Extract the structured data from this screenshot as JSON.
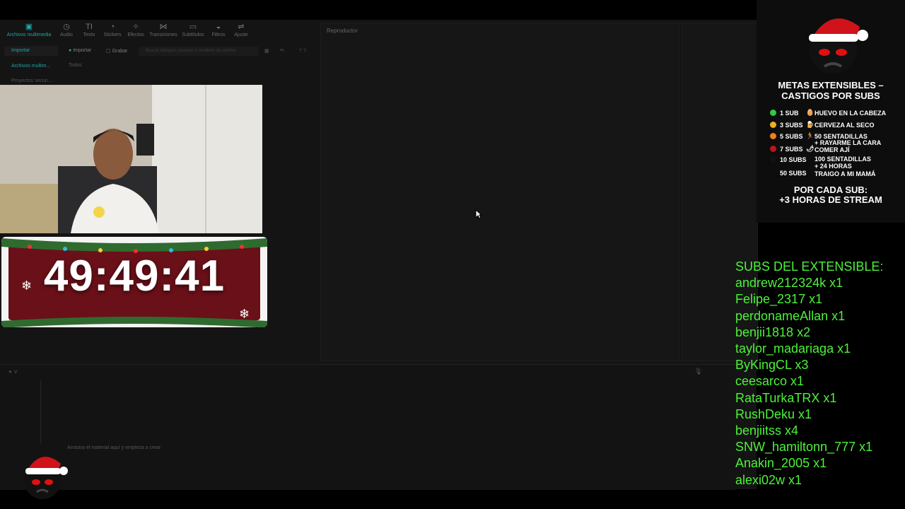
{
  "editor": {
    "toolbar": [
      {
        "label": "Archivos multimedia",
        "icon": "media-icon",
        "active": true
      },
      {
        "label": "Audio",
        "icon": "audio-icon"
      },
      {
        "label": "Texto",
        "icon": "text-icon"
      },
      {
        "label": "Stickers",
        "icon": "sticker-icon"
      },
      {
        "label": "Efectos",
        "icon": "effects-icon"
      },
      {
        "label": "Transiciones",
        "icon": "transitions-icon"
      },
      {
        "label": "Subtítulos",
        "icon": "subtitles-icon"
      },
      {
        "label": "Filtros",
        "icon": "filters-icon"
      },
      {
        "label": "Ajuste",
        "icon": "adjust-icon"
      }
    ],
    "left_nav": [
      "Importar",
      "Archivos multim...",
      "Proyectos secun..."
    ],
    "import_button": "Importar",
    "record_button": "Grabar",
    "search_placeholder": "Buscar diálogos, escenas o nombres de archivo",
    "filter_all": "Todos",
    "player_label": "Reproductor",
    "timeline_hint": "Arrastra el material aquí y empieza a crear"
  },
  "timer": {
    "value": "49:49:41"
  },
  "goals": {
    "title_line1": "METAS EXTENSIBLES –",
    "title_line2": "CASTIGOS POR SUBS",
    "rows": [
      {
        "subs": "1 SUB",
        "color": "#2ecc40",
        "emoji": "🥚",
        "reward": "HUEVO EN LA CABEZA"
      },
      {
        "subs": "3 SUBS",
        "color": "#f2b01e",
        "emoji": "🍺",
        "reward": "CERVEZA AL SECO"
      },
      {
        "subs": "5 SUBS",
        "color": "#f07f15",
        "emoji": "🏃",
        "reward": "50 SENTADILLAS"
      },
      {
        "subs": "",
        "color": "",
        "emoji": "",
        "reward": "+ RAYARME LA CARA"
      },
      {
        "subs": "7 SUBS",
        "color": "#c0141b",
        "emoji": "🌶",
        "reward": "COMER AJÍ"
      },
      {
        "subs": "10 SUBS",
        "color": "#111111",
        "emoji": "",
        "reward": "100 SENTADILLAS"
      },
      {
        "subs": "",
        "color": "",
        "emoji": "",
        "reward": "+ 24 HORAS"
      },
      {
        "subs": "50 SUBS",
        "color": "",
        "emoji": "",
        "reward": "TRAIGO A MI MAMÁ"
      }
    ],
    "footer_line1": "POR CADA SUB:",
    "footer_line2": "+3 HORAS DE STREAM"
  },
  "subs_list": {
    "header": "SUBS DEL EXTENSIBLE:",
    "entries": [
      "andrew212324k x1",
      "Felipe_2317 x1",
      "perdonameAllan x1",
      "benjii1818 x2",
      "taylor_madariaga x1",
      "ByKingCL x3",
      "ceesarco x1",
      "RataTurkaTRX x1",
      "RushDeku x1",
      "benjiitss x4",
      "SNW_hamiltonn_777 x1",
      "Anakin_2005 x1",
      "alexi02w x1"
    ]
  },
  "colors": {
    "accent": "#1fa7a7",
    "subs_green": "#4cf23a",
    "timer_bg": "#6a1018"
  }
}
